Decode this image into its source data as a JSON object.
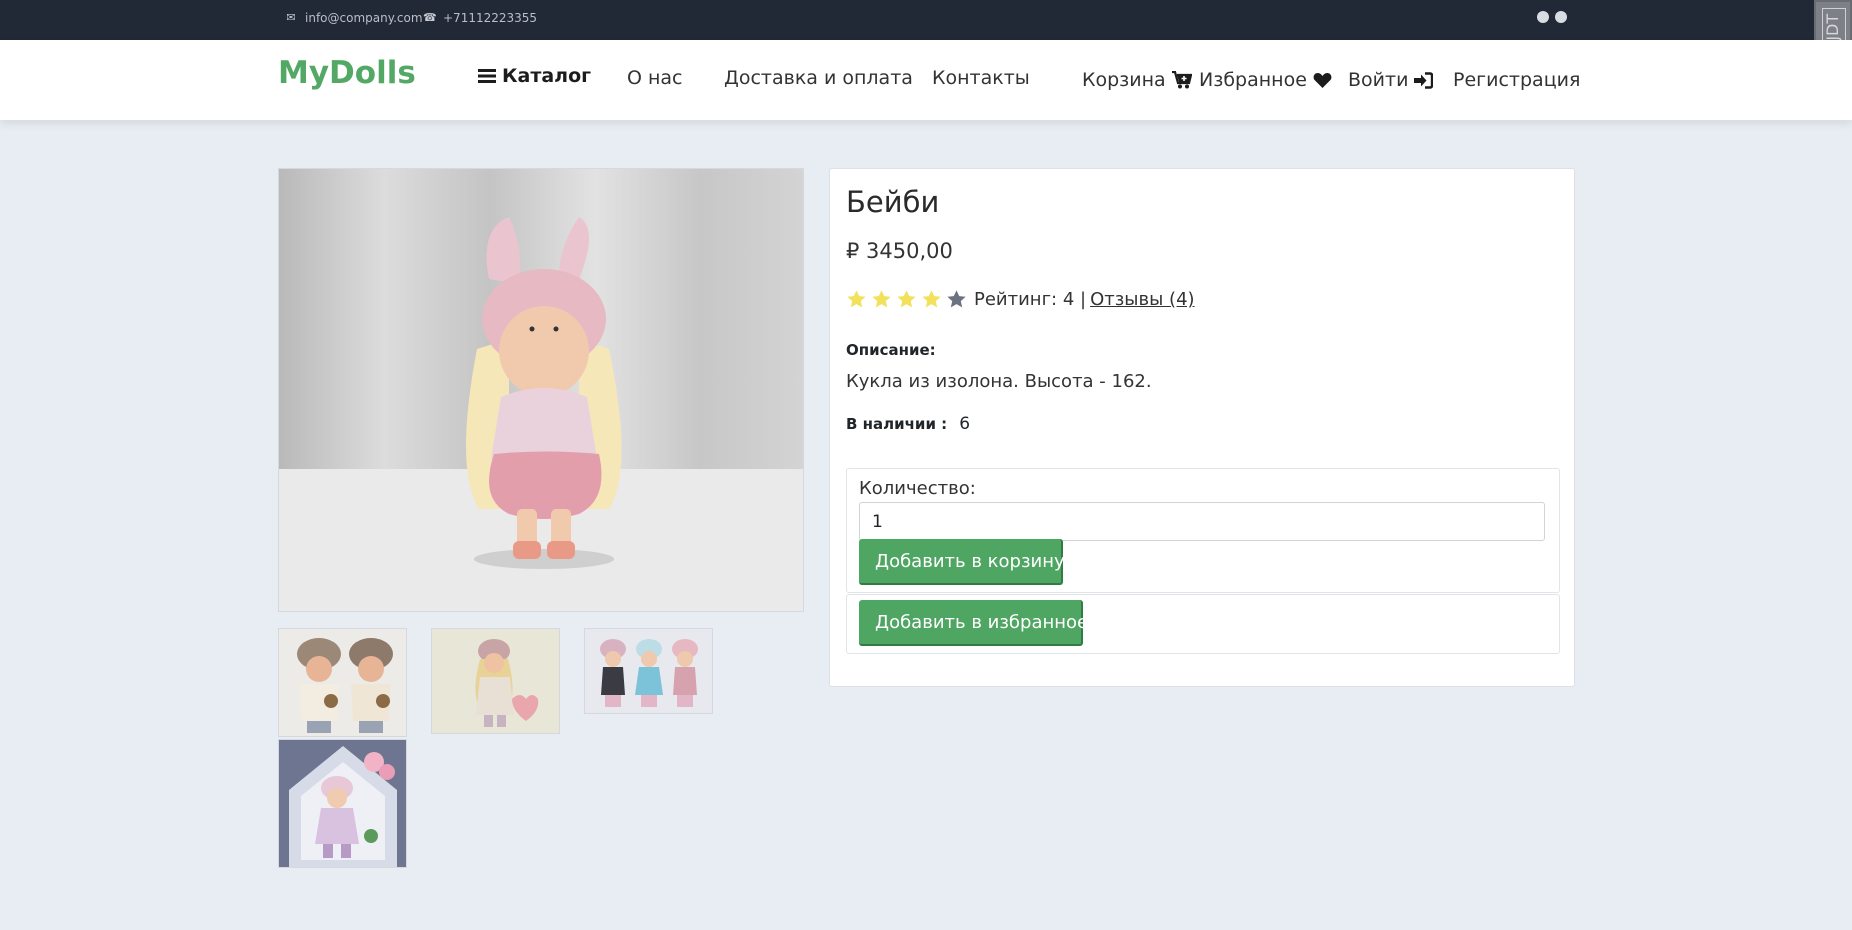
{
  "topbar": {
    "email": "info@company.com",
    "phone": "+71112223355",
    "icons": [
      "envelope-icon",
      "phone-icon",
      "telegram-icon",
      "whatsapp-icon"
    ]
  },
  "corner_badge": "DJDT",
  "navbar": {
    "brand": "MyDolls",
    "catalog": "Каталог",
    "about": "О нас",
    "delivery": "Доставка и оплата",
    "contacts": "Контакты",
    "cart": "Корзина",
    "favorites": "Избранное",
    "login": "Войти",
    "register": "Регистрация"
  },
  "product": {
    "title": "Бейби",
    "price": "₽ 3450,00",
    "rating_stars": 4,
    "rating_max": 5,
    "rating_text": "Рейтинг: 4 |",
    "reviews_link": "Отзывы (4)",
    "description_label": "Описание:",
    "description": "Кукла из изолона. Высота - 162.",
    "stock_label": "В наличии :",
    "stock_value": "6",
    "quantity_label": "Количество:",
    "quantity_value": "1",
    "add_to_cart": "Добавить в корзину",
    "add_to_favorites": "Добавить в избранное"
  },
  "colors": {
    "accent": "#52a864",
    "button": "#4fa562",
    "star_filled": "#f1e15b",
    "star_empty": "#6b7280",
    "topbar_bg": "#212836",
    "page_bg": "#e8edf3"
  }
}
